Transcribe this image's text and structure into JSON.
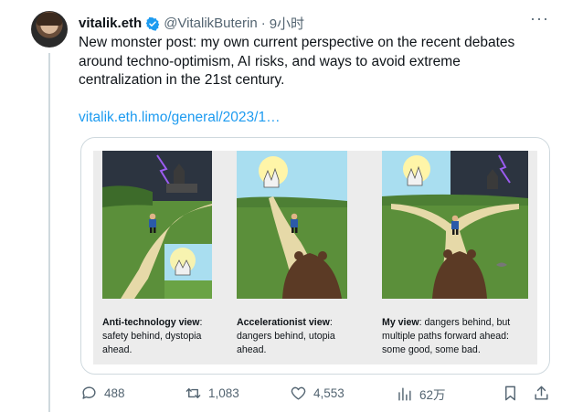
{
  "tweet": {
    "name": "vitalik.eth",
    "handle": "@VitalikButerin",
    "separator": "·",
    "time": "9小时",
    "text": "New monster post: my own current perspective on the recent debates around techno-optimism, AI risks, and ways to avoid extreme centralization in the 21st century.",
    "link": "vitalik.eth.limo/general/2023/1…",
    "more_icon": "more-dots-icon"
  },
  "card": {
    "captions": [
      {
        "title": "Anti-technology view",
        "body_line1": "safety behind, dystopia",
        "body_line2": "ahead.",
        "body_line3": ""
      },
      {
        "title": "Accelerationist view",
        "body_line1": "dangers behind, utopia",
        "body_line2": "ahead.",
        "body_line3": ""
      },
      {
        "title": "My view",
        "body_line1": "dangers behind, but",
        "body_line2": "multiple paths forward ahead:",
        "body_line3": "some good, some bad."
      }
    ],
    "colors": {
      "grass": "#5b8f3a",
      "path": "#e6d9a8",
      "sky": "#a9def0",
      "storm": "#2c3440",
      "bear": "#5b3a25",
      "lightning": "#9b5cf0"
    }
  },
  "actions": {
    "replies": "488",
    "retweets": "1,083",
    "likes": "4,553",
    "views": "62万"
  },
  "colors": {
    "accent": "#1d9bf0",
    "muted": "#536471"
  }
}
